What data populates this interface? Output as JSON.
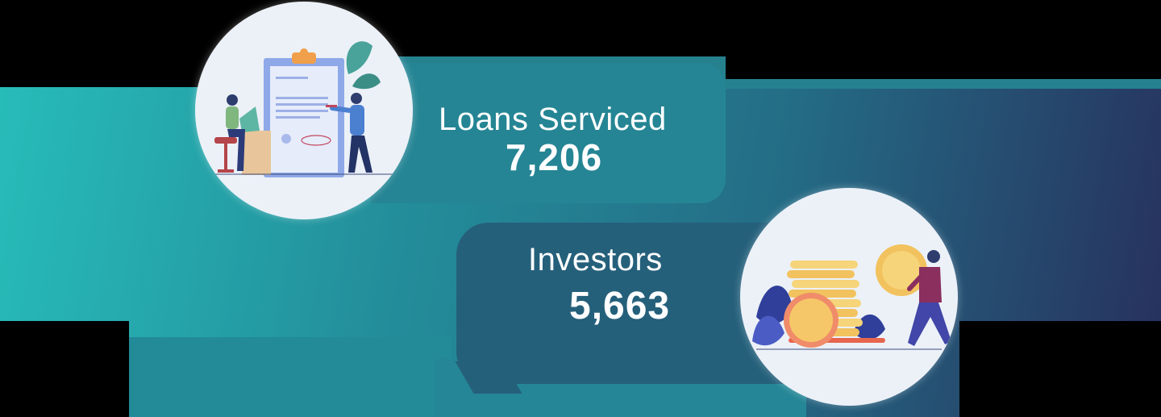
{
  "stats": {
    "loans": {
      "label": "Loans Serviced",
      "value": "7,206",
      "illustration": "contract-signing-illustration"
    },
    "investors": {
      "label": "Investors",
      "value": "5,663",
      "illustration": "coins-investor-illustration"
    }
  },
  "colors": {
    "gradient_start": "#27bcb9",
    "gradient_end": "#27305d",
    "text": "#ffffff",
    "circle_bg": "#ecf1f8"
  }
}
